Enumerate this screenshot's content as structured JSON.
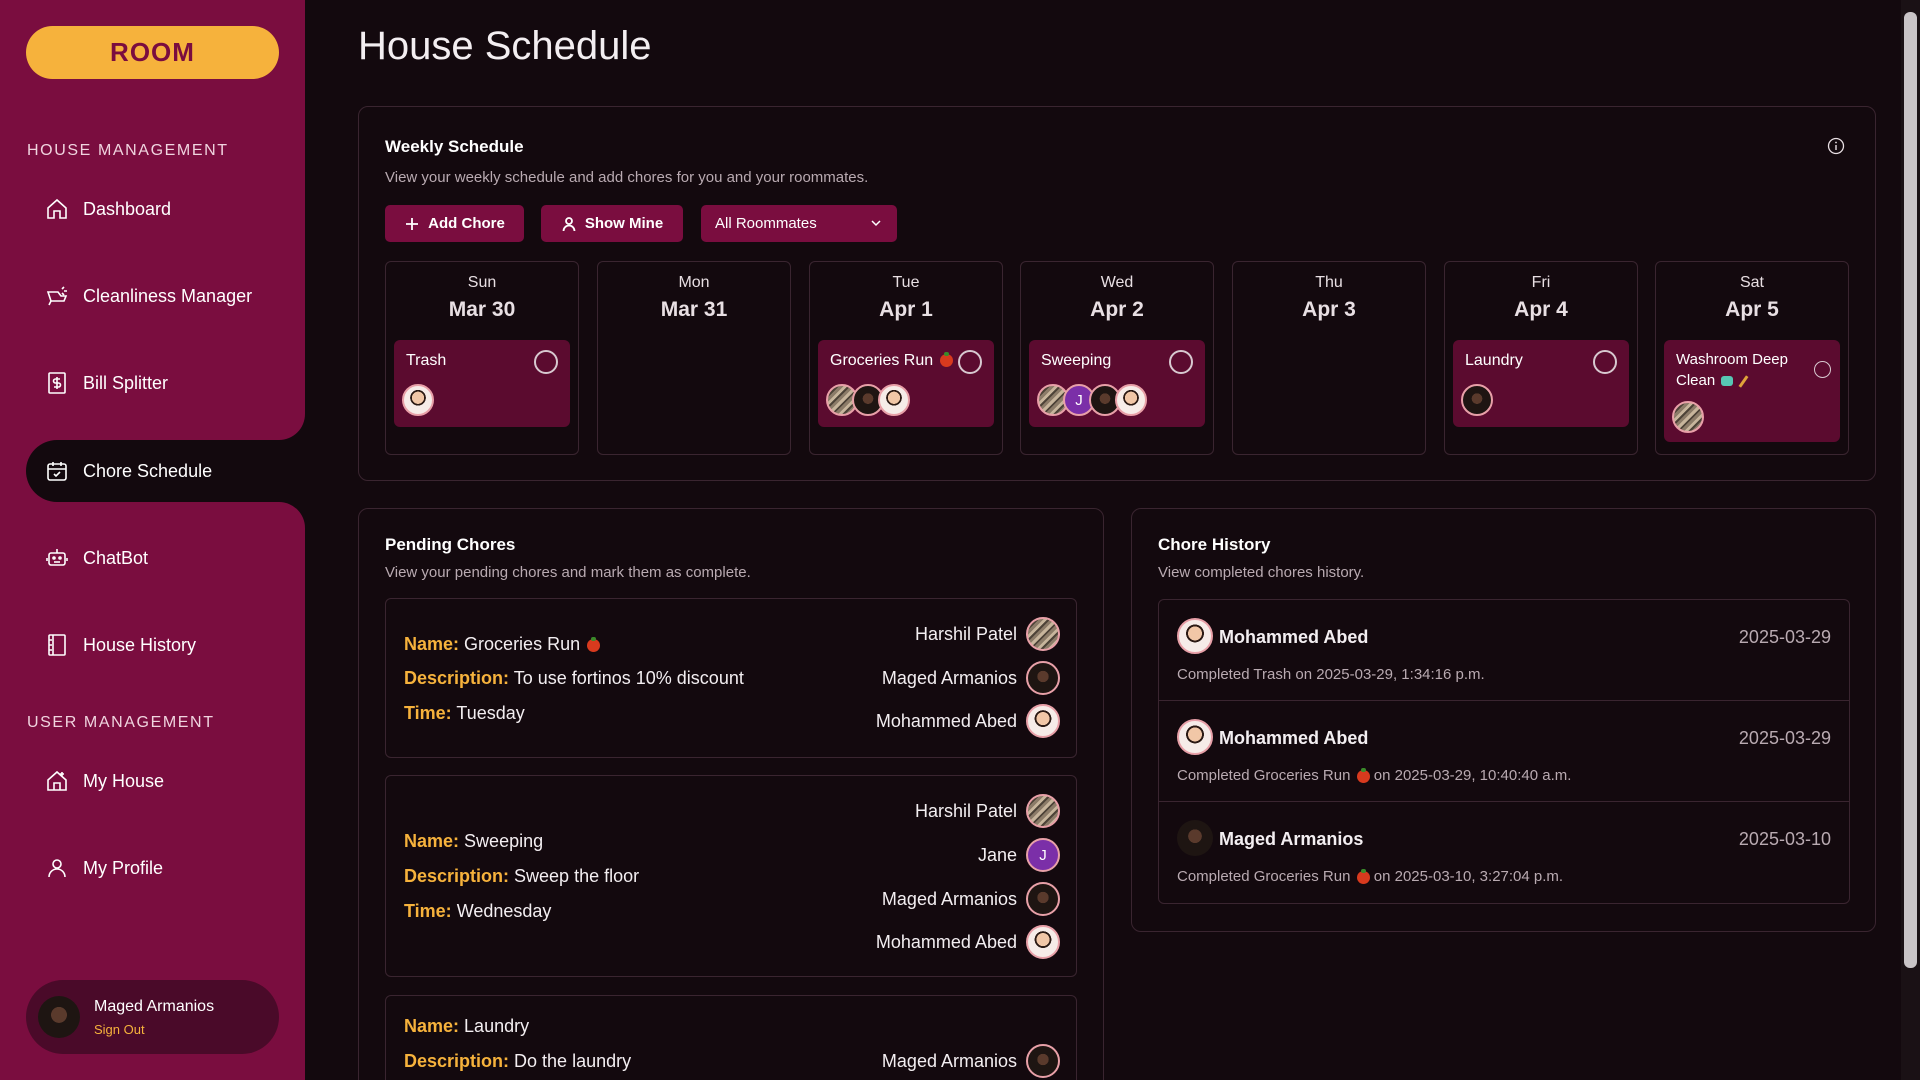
{
  "brand": {
    "logo": "ROOM"
  },
  "sidebar": {
    "house_section": "HOUSE MANAGEMENT",
    "user_section": "USER MANAGEMENT",
    "items": [
      {
        "label": "Dashboard",
        "icon": "home-icon"
      },
      {
        "label": "Cleanliness Manager",
        "icon": "spray-icon"
      },
      {
        "label": "Bill Splitter",
        "icon": "receipt-icon"
      },
      {
        "label": "Chore Schedule",
        "icon": "calendar-icon",
        "active": true
      },
      {
        "label": "ChatBot",
        "icon": "bot-icon"
      },
      {
        "label": "House History",
        "icon": "book-icon"
      },
      {
        "label": "My House",
        "icon": "house-plus-icon"
      },
      {
        "label": "My Profile",
        "icon": "user-icon"
      }
    ],
    "user": {
      "name": "Maged Armanios",
      "signout": "Sign Out"
    }
  },
  "page": {
    "title": "House Schedule"
  },
  "weekly": {
    "title": "Weekly Schedule",
    "subtitle": "View your weekly schedule and add chores for you and your roommates.",
    "add_chore": "Add Chore",
    "show_mine": "Show Mine",
    "filter_value": "All Roommates",
    "days": [
      {
        "name": "Sun",
        "date": "Mar 30",
        "chore": "Trash",
        "avatars": [
          "mo"
        ]
      },
      {
        "name": "Mon",
        "date": "Mar 31",
        "chore": "",
        "avatars": []
      },
      {
        "name": "Tue",
        "date": "Apr 1",
        "chore": "Groceries Run",
        "emoji": "tomato",
        "avatars": [
          "ha",
          "ma",
          "mo"
        ]
      },
      {
        "name": "Wed",
        "date": "Apr 2",
        "chore": "Sweeping",
        "avatars": [
          "ha",
          "j",
          "ma",
          "mo"
        ]
      },
      {
        "name": "Thu",
        "date": "Apr 3",
        "chore": "",
        "avatars": []
      },
      {
        "name": "Fri",
        "date": "Apr 4",
        "chore": "Laundry",
        "avatars": [
          "ma"
        ]
      },
      {
        "name": "Sat",
        "date": "Apr 5",
        "chore": "Washroom Deep Clean",
        "emoji": "soap broom",
        "avatars": [
          "ha"
        ]
      }
    ]
  },
  "pending": {
    "title": "Pending Chores",
    "subtitle": "View your pending chores and mark them as complete.",
    "labels": {
      "name": "Name:",
      "description": "Description:",
      "time": "Time:"
    },
    "items": [
      {
        "name": "Groceries Run",
        "description": "To use fortinos 10% discount",
        "time": "Tuesday",
        "people": [
          "Harshil Patel",
          "Maged Armanios",
          "Mohammed Abed"
        ]
      },
      {
        "name": "Sweeping",
        "description": "Sweep the floor",
        "time": "Wednesday",
        "people": [
          "Harshil Patel",
          "Jane",
          "Maged Armanios",
          "Mohammed Abed"
        ]
      },
      {
        "name": "Laundry",
        "description": "Do the laundry",
        "time": "",
        "people": [
          "Maged Armanios"
        ]
      }
    ]
  },
  "history": {
    "title": "Chore History",
    "subtitle": "View completed chores history.",
    "items": [
      {
        "name": "Mohammed Abed",
        "date": "2025-03-29",
        "desc": "Completed Trash on 2025-03-29, 1:34:16 p.m."
      },
      {
        "name": "Mohammed Abed",
        "date": "2025-03-29",
        "desc_a": "Completed Groceries Run",
        "desc_b": "on 2025-03-29, 10:40:40 a.m."
      },
      {
        "name": "Maged Armanios",
        "date": "2025-03-10",
        "desc_a": "Completed Groceries Run",
        "desc_b": "on 2025-03-10, 3:27:04 p.m."
      }
    ]
  },
  "colors": {
    "sidebar": "#7a0d3f",
    "accent": "#f6b23c",
    "chip": "#5b0b2f",
    "background": "#13090e"
  }
}
